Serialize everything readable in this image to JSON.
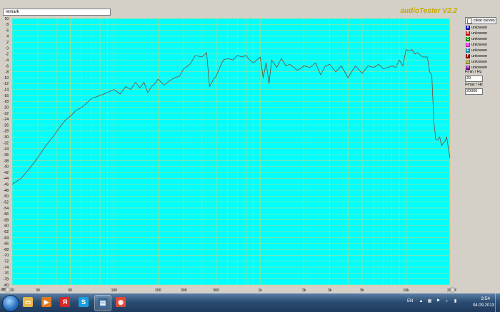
{
  "app": {
    "title": "audioTester V2.2",
    "remark_label": "remark"
  },
  "chart_data": {
    "type": "line",
    "title": "",
    "xlabel": "Hz",
    "ylabel": "dBFS",
    "x_scale": "log",
    "xlim": [
      20,
      20000
    ],
    "ylim": [
      -80,
      10
    ],
    "x_ticks": [
      {
        "v": 20,
        "label": "20"
      },
      {
        "v": 30,
        "label": "30"
      },
      {
        "v": 50,
        "label": "50"
      },
      {
        "v": 100,
        "label": "100"
      },
      {
        "v": 200,
        "label": "200"
      },
      {
        "v": 300,
        "label": "300"
      },
      {
        "v": 500,
        "label": "500"
      },
      {
        "v": 1000,
        "label": "1k"
      },
      {
        "v": 2000,
        "label": "2k"
      },
      {
        "v": 3000,
        "label": "3k"
      },
      {
        "v": 5000,
        "label": "5k"
      },
      {
        "v": 10000,
        "label": "10k"
      },
      {
        "v": 20000,
        "label": "20k"
      }
    ],
    "y_tick_step": 2,
    "grid": true,
    "series": [
      {
        "color": "#6b4a3a",
        "x": [
          20,
          23,
          26,
          30,
          34,
          38,
          42,
          46,
          50,
          55,
          60,
          65,
          70,
          75,
          80,
          85,
          90,
          95,
          100,
          110,
          120,
          130,
          140,
          150,
          160,
          170,
          180,
          190,
          200,
          220,
          240,
          260,
          280,
          300,
          330,
          360,
          400,
          430,
          450,
          480,
          500,
          530,
          560,
          600,
          650,
          700,
          750,
          800,
          850,
          900,
          1000,
          1050,
          1100,
          1150,
          1200,
          1300,
          1400,
          1500,
          1600,
          1800,
          2000,
          2200,
          2400,
          2600,
          2800,
          3000,
          3300,
          3600,
          4000,
          4500,
          5000,
          5500,
          6000,
          6500,
          7000,
          7500,
          8000,
          8500,
          9000,
          9500,
          10000,
          10500,
          11000,
          11500,
          12000,
          13000,
          14000,
          14500,
          15000,
          15500,
          16000,
          16500,
          17000,
          17500,
          18000,
          18500,
          19000,
          19500,
          20000
        ],
        "y": [
          -46,
          -44,
          -41,
          -37,
          -33,
          -30,
          -27,
          -24.5,
          -23,
          -21,
          -20,
          -18.5,
          -17,
          -16.5,
          -16,
          -15.5,
          -15,
          -14.5,
          -14,
          -15.5,
          -13,
          -14,
          -11.5,
          -13.5,
          -11.5,
          -15,
          -13,
          -12,
          -10.5,
          -12.5,
          -11,
          -10,
          -9.5,
          -7,
          -5.5,
          -2.5,
          -3,
          -1.5,
          -13,
          -10.5,
          -9.5,
          -6.5,
          -4,
          -3.5,
          -4,
          -2.5,
          -3,
          -2.5,
          -4,
          -5,
          -3,
          -10,
          -5,
          -12,
          -4,
          -6.5,
          -3.5,
          -6,
          -5.5,
          -7.5,
          -6,
          -6.5,
          -5,
          -9,
          -6,
          -5.5,
          -8,
          -6,
          -10,
          -6,
          -8.5,
          -6,
          -6.5,
          -5.5,
          -7,
          -6.5,
          -6,
          -6.5,
          -4,
          -6,
          -0.5,
          -1,
          -0.5,
          -2,
          -1.5,
          -3,
          -3,
          -8,
          -9,
          -25,
          -31,
          -31,
          -30,
          -33,
          -32,
          -31.5,
          -30,
          -34,
          -37
        ]
      }
    ]
  },
  "legend": {
    "clear_label": "clear curves",
    "items": [
      {
        "letter": "A",
        "label": "unknown",
        "color": "#0000c0"
      },
      {
        "letter": "B",
        "label": "unknown",
        "color": "#c00000"
      },
      {
        "letter": "C",
        "label": "unknown",
        "color": "#008800"
      },
      {
        "letter": "D",
        "label": "unknown",
        "color": "#cc00cc"
      },
      {
        "letter": "E",
        "label": "unknown",
        "color": "#0088aa"
      },
      {
        "letter": "F",
        "label": "unknown",
        "color": "#880000"
      },
      {
        "letter": "G",
        "label": "unknown",
        "color": "#888800"
      },
      {
        "letter": "H",
        "label": "unknown",
        "color": "#660088"
      }
    ]
  },
  "fields": {
    "fmin_label": "Fmin / Hz",
    "fmin_value": "20",
    "fmax_label": "Fmax / Hz",
    "fmax_value": "20000"
  },
  "taskbar": {
    "language": "EN",
    "time": "3:54",
    "date": "04.09.2013",
    "apps": [
      {
        "name": "explorer",
        "glyph": "▭",
        "color": "#e8b84a"
      },
      {
        "name": "media-player",
        "glyph": "▶",
        "color": "#e07a20"
      },
      {
        "name": "yandex",
        "glyph": "Я",
        "color": "#d42a2a"
      },
      {
        "name": "skype",
        "glyph": "S",
        "color": "#1a9ee0"
      },
      {
        "name": "audiotester",
        "glyph": "▤",
        "color": "#3a6a9a"
      },
      {
        "name": "chrome",
        "glyph": "◉",
        "color": "#dd4b39"
      }
    ]
  }
}
